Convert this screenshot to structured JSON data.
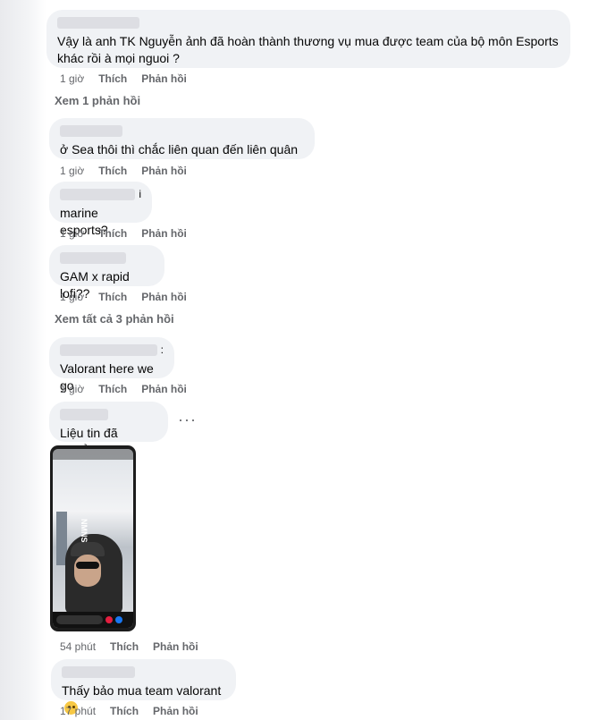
{
  "comments": [
    {
      "text": "Vậy là anh TK Nguyễn ảnh đã hoàn thành thương vụ mua được team của bộ môn Esports khác rồi à mọi nguoi ?",
      "time": "1 giờ",
      "like": "Thích",
      "reply": "Phản hồi"
    },
    {
      "text": "ở Sea thôi thì chắc liên quan đến liên quân",
      "time": "1 giờ",
      "like": "Thích",
      "reply": "Phản hồi"
    },
    {
      "name_tail": "i",
      "text": "marine esports?",
      "time": "1 giờ",
      "like": "Thích",
      "reply": "Phản hồi"
    },
    {
      "text": "GAM x rapid lofi??",
      "time": "1 giờ",
      "like": "Thích",
      "reply": "Phản hồi"
    },
    {
      "name_tail": ":",
      "text": "Valorant here we go",
      "time": "1 giờ",
      "like": "Thích",
      "reply": "Phản hồi"
    },
    {
      "text": "Liệu tin đã chuẩn:))",
      "time": "54 phút",
      "like": "Thích",
      "reply": "Phản hồi"
    },
    {
      "text": "Thấy bảo mua team valorant",
      "time": "17 phút",
      "like": "Thích",
      "reply": "Phản hồi"
    }
  ],
  "view_replies": {
    "first": "Xem 1 phản hồi",
    "second": "Xem tất cả 3 phản hồi"
  },
  "more_menu": "···",
  "attachment": {
    "shirt_text": "NMNS"
  },
  "colors": {
    "bubble": "#f0f2f5",
    "meta": "#65676b",
    "text": "#050505"
  },
  "icons": {
    "emoji": "face-with-monocle-emoji",
    "more": "more-options-icon"
  }
}
